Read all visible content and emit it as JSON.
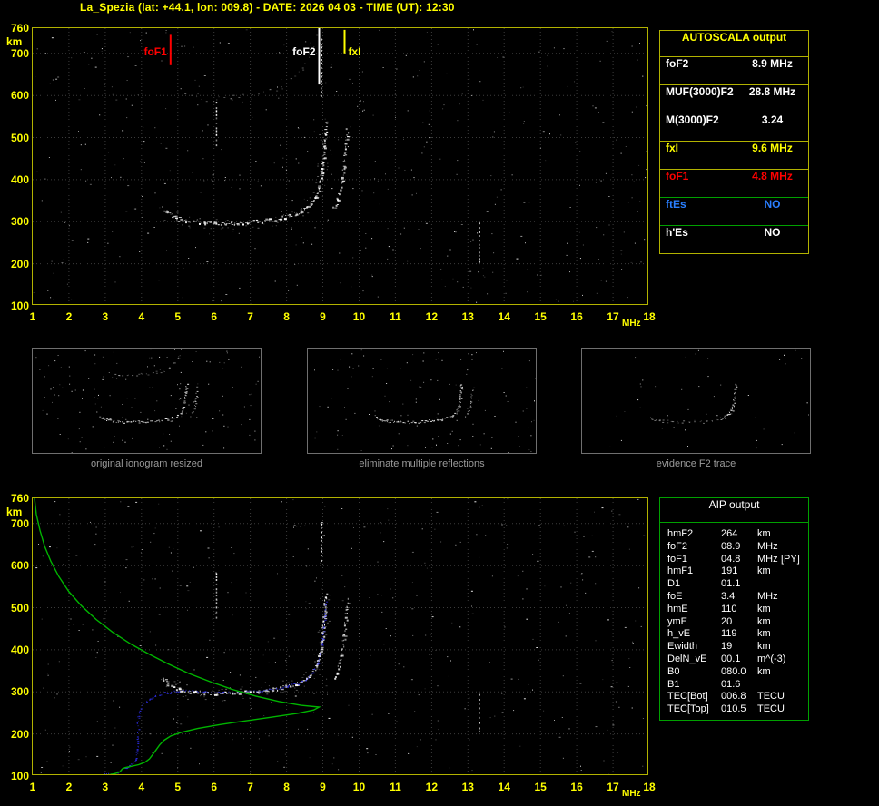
{
  "header": {
    "title": "La_Spezia (lat: +44.1, lon: 009.8) - DATE: 2026 04 03 - TIME (UT): 12:30"
  },
  "autoscala_table": {
    "title": "AUTOSCALA output",
    "rows": [
      {
        "label": "foF2",
        "value": "8.9 MHz",
        "color": "#ffffff"
      },
      {
        "label": "MUF(3000)F2",
        "value": "28.8 MHz",
        "color": "#ffffff"
      },
      {
        "label": "M(3000)F2",
        "value": "3.24",
        "color": "#ffffff"
      },
      {
        "label": "fxI",
        "value": "9.6 MHz",
        "color": "#ffff00"
      },
      {
        "label": "foF1",
        "value": "4.8 MHz",
        "color": "#ff0000"
      },
      {
        "label": "ftEs",
        "value": "NO",
        "color": "#2a7fff"
      },
      {
        "label": "h'Es",
        "value": "NO",
        "color": "#ffffff"
      }
    ]
  },
  "thumbnails": [
    {
      "caption": "original ionogram resized"
    },
    {
      "caption": "eliminate multiple reflections"
    },
    {
      "caption": "evidence F2 trace"
    }
  ],
  "aip_table": {
    "title": "AIP output",
    "rows": [
      {
        "label": "hmF2",
        "value": "264",
        "unit": "km",
        "note": ""
      },
      {
        "label": "foF2",
        "value": "08.9",
        "unit": "MHz",
        "note": ""
      },
      {
        "label": "foF1",
        "value": "04.8",
        "unit": "MHz",
        "note": "[PY]"
      },
      {
        "label": "hmF1",
        "value": "191",
        "unit": "km",
        "note": ""
      },
      {
        "label": "D1",
        "value": "01.1",
        "unit": "",
        "note": ""
      },
      {
        "label": "foE",
        "value": "3.4",
        "unit": "MHz",
        "note": ""
      },
      {
        "label": "hmE",
        "value": "110",
        "unit": "km",
        "note": ""
      },
      {
        "label": "ymE",
        "value": "20",
        "unit": "km",
        "note": ""
      },
      {
        "label": "h_vE",
        "value": "119",
        "unit": "km",
        "note": ""
      },
      {
        "label": "Ewidth",
        "value": "19",
        "unit": "km",
        "note": ""
      },
      {
        "label": "DelN_vE",
        "value": "00.1",
        "unit": "m^(-3)",
        "note": ""
      },
      {
        "label": "B0",
        "value": "080.0",
        "unit": "km",
        "note": ""
      },
      {
        "label": "B1",
        "value": "01.6",
        "unit": "",
        "note": ""
      },
      {
        "label": "TEC[Bot]",
        "value": "006.8",
        "unit": "TECU",
        "note": ""
      },
      {
        "label": "TEC[Top]",
        "value": "010.5",
        "unit": "TECU",
        "note": ""
      }
    ]
  },
  "chart_data": [
    {
      "type": "scatter",
      "xlabel": "MHz",
      "ylabel": "km",
      "xlim": [
        1,
        18
      ],
      "ylim": [
        100,
        760
      ],
      "xticks": [
        1,
        2,
        3,
        4,
        5,
        6,
        7,
        8,
        9,
        10,
        11,
        12,
        13,
        14,
        15,
        16,
        17,
        18
      ],
      "yticks": [
        760,
        700,
        600,
        500,
        400,
        300,
        200,
        100
      ],
      "grid": true,
      "markers": [
        {
          "name": "foF1",
          "freq_mhz": 4.8,
          "color": "#ff0000",
          "km_span": [
            672,
            744
          ],
          "label_side": "left"
        },
        {
          "name": "foF2",
          "freq_mhz": 8.9,
          "color": "#ffffff",
          "km_span": [
            626,
            760
          ],
          "label_side": "left"
        },
        {
          "name": "fxI",
          "freq_mhz": 9.6,
          "color": "#ffff00",
          "km_span": [
            700,
            756
          ],
          "label_side": "right"
        }
      ],
      "o_trace": [
        [
          4.55,
          332
        ],
        [
          4.7,
          320
        ],
        [
          4.85,
          313
        ],
        [
          5.0,
          308
        ],
        [
          5.2,
          304
        ],
        [
          5.45,
          301
        ],
        [
          5.7,
          299
        ],
        [
          6.0,
          297
        ],
        [
          6.3,
          297
        ],
        [
          6.6,
          298
        ],
        [
          6.9,
          300
        ],
        [
          7.2,
          302
        ],
        [
          7.5,
          305
        ],
        [
          7.8,
          309
        ],
        [
          8.05,
          314
        ],
        [
          8.3,
          321
        ],
        [
          8.5,
          330
        ],
        [
          8.65,
          341
        ],
        [
          8.78,
          356
        ],
        [
          8.87,
          375
        ],
        [
          8.93,
          398
        ],
        [
          8.97,
          424
        ],
        [
          9.0,
          452
        ],
        [
          9.03,
          482
        ],
        [
          9.06,
          512
        ],
        [
          9.08,
          535
        ]
      ],
      "x_trace": [
        [
          9.3,
          332
        ],
        [
          9.38,
          350
        ],
        [
          9.46,
          374
        ],
        [
          9.52,
          400
        ],
        [
          9.57,
          430
        ],
        [
          9.61,
          462
        ],
        [
          9.64,
          495
        ],
        [
          9.66,
          520
        ]
      ],
      "second_hop": [
        [
          5.0,
          612
        ],
        [
          5.5,
          598
        ],
        [
          6.0,
          592
        ],
        [
          6.5,
          594
        ],
        [
          7.0,
          600
        ],
        [
          7.5,
          610
        ],
        [
          7.9,
          624
        ],
        [
          8.2,
          642
        ],
        [
          8.45,
          666
        ],
        [
          8.6,
          692
        ],
        [
          8.72,
          722
        ],
        [
          8.8,
          750
        ]
      ],
      "streaks": [
        [
          6.05,
          475,
          585
        ],
        [
          13.3,
          200,
          298
        ],
        [
          8.95,
          600,
          735
        ]
      ]
    },
    {
      "type": "scatter",
      "xlabel": "MHz",
      "ylabel": "km",
      "xlim": [
        1,
        18
      ],
      "ylim": [
        100,
        760
      ],
      "xticks": [
        1,
        2,
        3,
        4,
        5,
        6,
        7,
        8,
        9,
        10,
        11,
        12,
        13,
        14,
        15,
        16,
        17,
        18
      ],
      "yticks": [
        760,
        700,
        600,
        500,
        400,
        300,
        200,
        100
      ],
      "grid": true,
      "o_trace": [
        [
          4.55,
          332
        ],
        [
          4.7,
          320
        ],
        [
          4.85,
          313
        ],
        [
          5.0,
          308
        ],
        [
          5.2,
          304
        ],
        [
          5.45,
          301
        ],
        [
          5.7,
          299
        ],
        [
          6.0,
          297
        ],
        [
          6.3,
          297
        ],
        [
          6.6,
          298
        ],
        [
          6.9,
          300
        ],
        [
          7.2,
          302
        ],
        [
          7.5,
          305
        ],
        [
          7.8,
          309
        ],
        [
          8.05,
          314
        ],
        [
          8.3,
          321
        ],
        [
          8.5,
          330
        ],
        [
          8.65,
          341
        ],
        [
          8.78,
          356
        ],
        [
          8.87,
          375
        ],
        [
          8.93,
          398
        ],
        [
          8.97,
          424
        ],
        [
          9.0,
          452
        ],
        [
          9.03,
          482
        ],
        [
          9.06,
          512
        ],
        [
          9.08,
          535
        ]
      ],
      "x_trace": [
        [
          9.3,
          332
        ],
        [
          9.38,
          350
        ],
        [
          9.46,
          374
        ],
        [
          9.52,
          400
        ],
        [
          9.57,
          430
        ],
        [
          9.61,
          462
        ],
        [
          9.64,
          495
        ],
        [
          9.66,
          520
        ]
      ],
      "streaks": [
        [
          6.05,
          478,
          582
        ],
        [
          13.3,
          205,
          295
        ],
        [
          8.95,
          610,
          700
        ]
      ],
      "restored_color": "#3232ff",
      "restored_trace": [
        [
          2.6,
          101
        ],
        [
          2.85,
          103
        ],
        [
          3.1,
          106
        ],
        [
          3.35,
          110
        ],
        [
          3.55,
          117
        ],
        [
          3.72,
          127
        ],
        [
          3.82,
          140
        ],
        [
          3.87,
          155
        ],
        [
          3.9,
          172
        ],
        [
          3.88,
          190
        ],
        [
          3.9,
          208
        ],
        [
          3.88,
          225
        ],
        [
          3.9,
          242
        ],
        [
          3.96,
          258
        ],
        [
          4.06,
          272
        ],
        [
          4.2,
          283
        ],
        [
          4.4,
          292
        ],
        [
          4.65,
          298
        ],
        [
          4.95,
          302
        ],
        [
          5.3,
          303
        ],
        [
          5.7,
          301
        ],
        [
          6.1,
          299
        ],
        [
          6.5,
          299
        ],
        [
          6.9,
          301
        ],
        [
          7.3,
          304
        ],
        [
          7.7,
          308
        ],
        [
          8.0,
          313
        ],
        [
          8.3,
          321
        ],
        [
          8.55,
          332
        ],
        [
          8.72,
          347
        ],
        [
          8.85,
          368
        ],
        [
          8.93,
          394
        ],
        [
          8.98,
          424
        ],
        [
          9.02,
          456
        ],
        [
          9.05,
          488
        ],
        [
          9.07,
          515
        ]
      ],
      "profile_color": "#00b400",
      "profile_mhz_km": [
        [
          1.05,
          760
        ],
        [
          1.1,
          722
        ],
        [
          1.2,
          684
        ],
        [
          1.33,
          646
        ],
        [
          1.5,
          610
        ],
        [
          1.72,
          574
        ],
        [
          2.0,
          538
        ],
        [
          2.35,
          504
        ],
        [
          2.75,
          472
        ],
        [
          3.2,
          442
        ],
        [
          3.7,
          414
        ],
        [
          4.2,
          390
        ],
        [
          4.75,
          366
        ],
        [
          5.3,
          344
        ],
        [
          5.9,
          324
        ],
        [
          6.5,
          306
        ],
        [
          7.15,
          290
        ],
        [
          7.8,
          277
        ],
        [
          8.4,
          268
        ],
        [
          8.9,
          264
        ],
        [
          8.75,
          257
        ],
        [
          8.3,
          249
        ],
        [
          7.6,
          240
        ],
        [
          6.85,
          231
        ],
        [
          6.15,
          222
        ],
        [
          5.55,
          213
        ],
        [
          5.1,
          204
        ],
        [
          4.8,
          195
        ],
        [
          4.62,
          185
        ],
        [
          4.5,
          174
        ],
        [
          4.4,
          162
        ],
        [
          4.3,
          150
        ],
        [
          4.22,
          141
        ],
        [
          4.1,
          133
        ],
        [
          3.92,
          127
        ],
        [
          3.72,
          123
        ],
        [
          3.55,
          120
        ],
        [
          3.47,
          117
        ],
        [
          3.43,
          113
        ],
        [
          3.4,
          110
        ],
        [
          3.28,
          106
        ],
        [
          3.1,
          103
        ],
        [
          2.95,
          101
        ]
      ]
    }
  ]
}
